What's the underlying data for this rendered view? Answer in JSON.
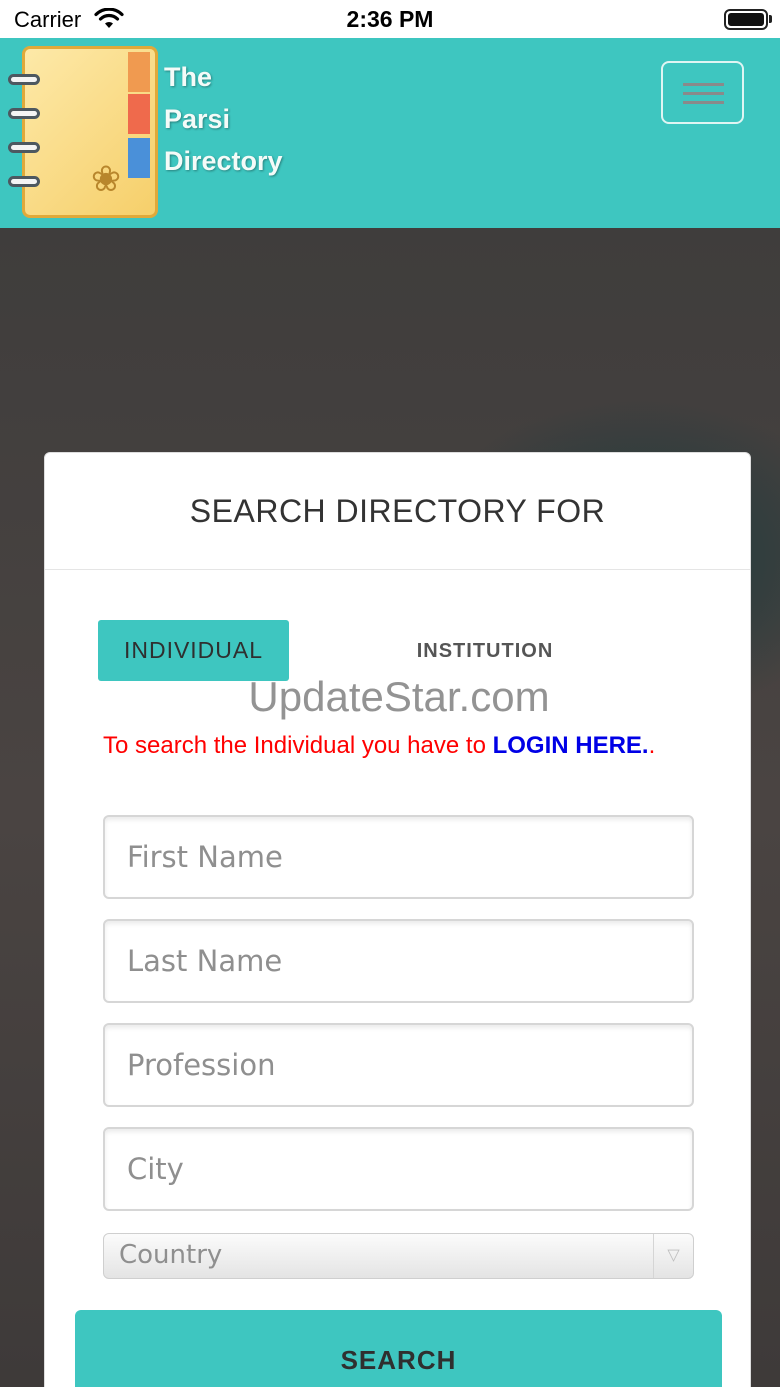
{
  "status_bar": {
    "carrier": "Carrier",
    "time": "2:36 PM"
  },
  "header": {
    "logo_lines": [
      "The",
      "Parsi",
      "Directory"
    ],
    "menu_icon": "hamburger-menu-icon",
    "background_color": "#3ec6c0"
  },
  "card": {
    "heading": "SEARCH DIRECTORY FOR",
    "tabs": {
      "individual": "INDIVIDUAL",
      "institution": "INSTITUTION"
    },
    "watermark": "UpdateStar.com",
    "notice": {
      "text": "To search the Individual you have to ",
      "link": "LOGIN HERE.",
      "trailing": "."
    },
    "fields": {
      "first_name_placeholder": "First Name",
      "last_name_placeholder": "Last Name",
      "profession_placeholder": "Profession",
      "city_placeholder": "City"
    },
    "country_select": {
      "value": "Country"
    },
    "search_button": "SEARCH"
  },
  "colors": {
    "accent": "#3ec6c0",
    "notice_red": "#ff0000",
    "link_blue": "#0000e6"
  }
}
